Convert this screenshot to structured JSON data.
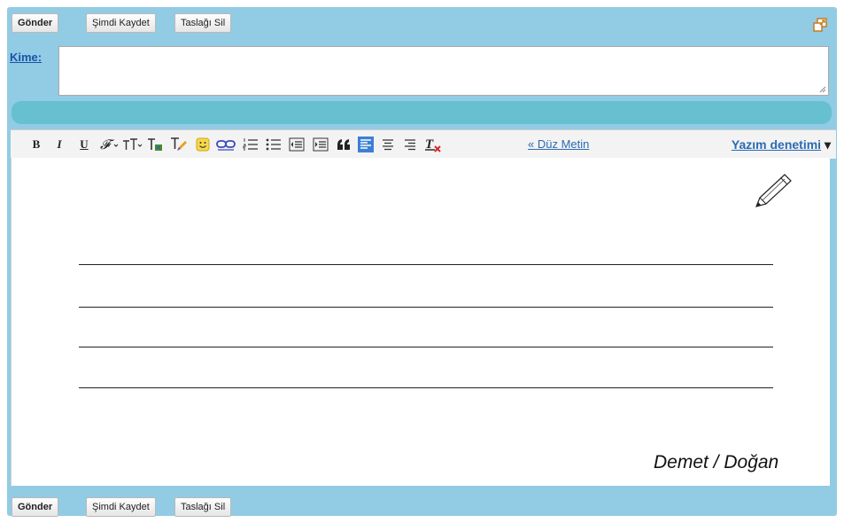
{
  "top_actions": {
    "send": "Gönder",
    "save_now": "Şimdi Kaydet",
    "discard": "Taslağı Sil"
  },
  "bottom_actions": {
    "send": "Gönder",
    "save_now": "Şimdi Kaydet",
    "discard": "Taslağı Sil"
  },
  "to_label": "Kime:",
  "to_value": "",
  "toolbar": {
    "bold": "B",
    "italic": "I",
    "underline": "U",
    "plain_text_link": "« Düz Metin",
    "spellcheck_label": "Yazım denetimi",
    "spellcheck_arrow": "▾"
  },
  "icons": [
    "bold-icon",
    "italic-icon",
    "underline-icon",
    "font-icon",
    "font-size-icon",
    "text-color-icon",
    "highlight-color-icon",
    "emoji-icon",
    "link-icon",
    "numbered-list-icon",
    "bulleted-list-icon",
    "outdent-icon",
    "indent-icon",
    "quote-icon",
    "align-left-icon",
    "align-center-icon",
    "align-right-icon",
    "remove-formatting-icon",
    "popout-icon",
    "pencil-icon"
  ],
  "signature": "Demet / Doğan",
  "colors": {
    "frame": "#92cbe4",
    "teal_bar": "#66c0cf",
    "link": "#2a6ab4"
  }
}
